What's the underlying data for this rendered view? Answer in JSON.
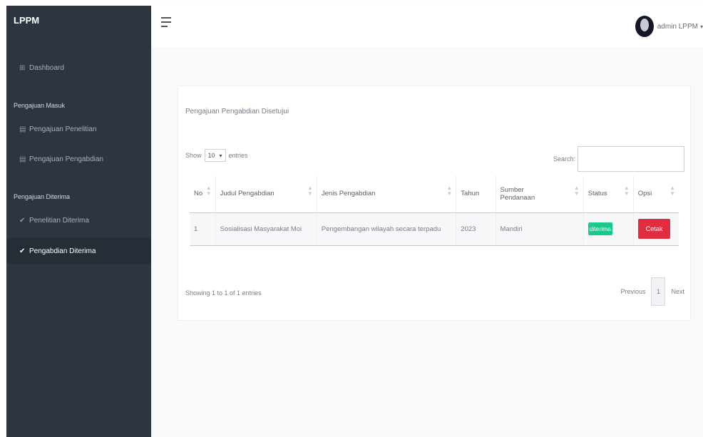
{
  "sidebar": {
    "brand": "LPPM",
    "dashboard": "Dashboard",
    "section1": "Pengajuan Masuk",
    "item_penelitian": "Pengajuan Penelitian",
    "item_pengabdian": "Pengajuan Pengabdian",
    "section2": "Pengajuan Diterima",
    "item_penelitian_diterima": "Penelitian Diterima",
    "item_pengabdian_diterima": "Pengabdian Diterima"
  },
  "topbar": {
    "user_name": "admin LPPM"
  },
  "card": {
    "title": "Pengajuan Pengabdian Disetujui",
    "show_label": "Show",
    "entries_value": "10",
    "entries_label": "entries",
    "search_label": "Search:",
    "search_value": ""
  },
  "table": {
    "headers": [
      "No",
      "Judul Pengabdian",
      "Jenis Pengabdian",
      "Tahun",
      "Sumber Pendanaan",
      "Status",
      "Opsi"
    ],
    "rows": [
      {
        "no": "1",
        "judul": "Sosialisasi Masyarakat Moi",
        "jenis": "Pengembangan wilayah secara terpadu",
        "tahun": "2023",
        "sumber": "Mandiri",
        "status": "diterima",
        "opsi": "Cetak"
      }
    ]
  },
  "footer": {
    "info": "Showing 1 to 1 of 1 entries",
    "previous": "Previous",
    "page": "1",
    "next": "Next"
  },
  "colors": {
    "sidebar_bg": "#2c3540",
    "status_green": "#1cc88a",
    "cetak_red": "#e02d3f"
  }
}
